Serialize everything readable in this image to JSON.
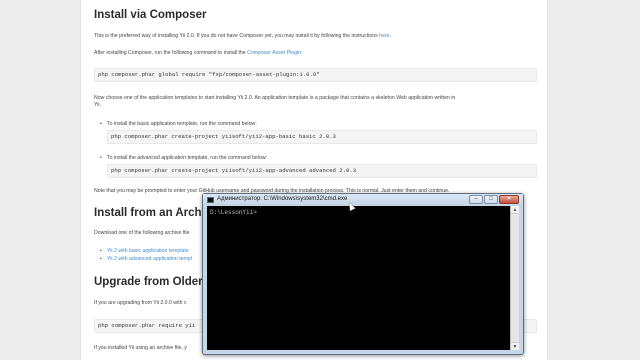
{
  "doc": {
    "composer_heading": "Install via Composer",
    "composer_p1_pre": "This is the preferred way of installing Yii 2.0. If you do not have Composer yet, you may install it by following the instructions ",
    "composer_p1_link": "here",
    "composer_p1_post": ".",
    "composer_p2_pre": "After installing Composer, run the following command to install the ",
    "composer_p2_link": "Composer Asset Plugin",
    "composer_p2_post": ":",
    "code_global": "php composer.phar global require \"fxp/composer-asset-plugin:1.0.0\"",
    "templates_p_line1": "Now choose one of the application templates to start installing Yii 2.0. An application template is a package that contains a skeleton Web application written in",
    "templates_p_line2": "Yii.",
    "bullet_basic": "To install the basic application template, run the command below:",
    "code_basic": "php composer.phar create-project yiisoft/yii2-app-basic basic 2.0.3",
    "bullet_advanced": "To install the advanced application template, run the command below:",
    "code_advanced": "php composer.phar create-project yiisoft/yii2-app-advanced advanced 2.0.3",
    "note_p": "Note that you may be prompted to enter your GitHub username and password during the installation process. This is normal. Just enter them and continue.",
    "archive_heading": "Install from an Archive F",
    "archive_p": "Download one of the following archive file",
    "archive_link_basic": "Yii 2 with basic application template",
    "archive_link_advanced": "Yii 2 with advanced application templ",
    "upgrade_heading": "Upgrade from Older Ver",
    "upgrade_p": "If you are upgrading from Yii 2.0.0 with c",
    "code_upgrade": "php composer.phar require yii",
    "last_p": "If you installed Yii using an archive file, y"
  },
  "cmd": {
    "title": "Администратор: C:\\Windows\\system32\\cmd.exe",
    "prompt": "D:\\LessonYii>",
    "btn_min": "–",
    "btn_max": "□",
    "btn_close": "✕"
  },
  "colors": {
    "link": "#428bca",
    "terminal_bg": "#000000",
    "terminal_text": "#c0c0c0"
  }
}
